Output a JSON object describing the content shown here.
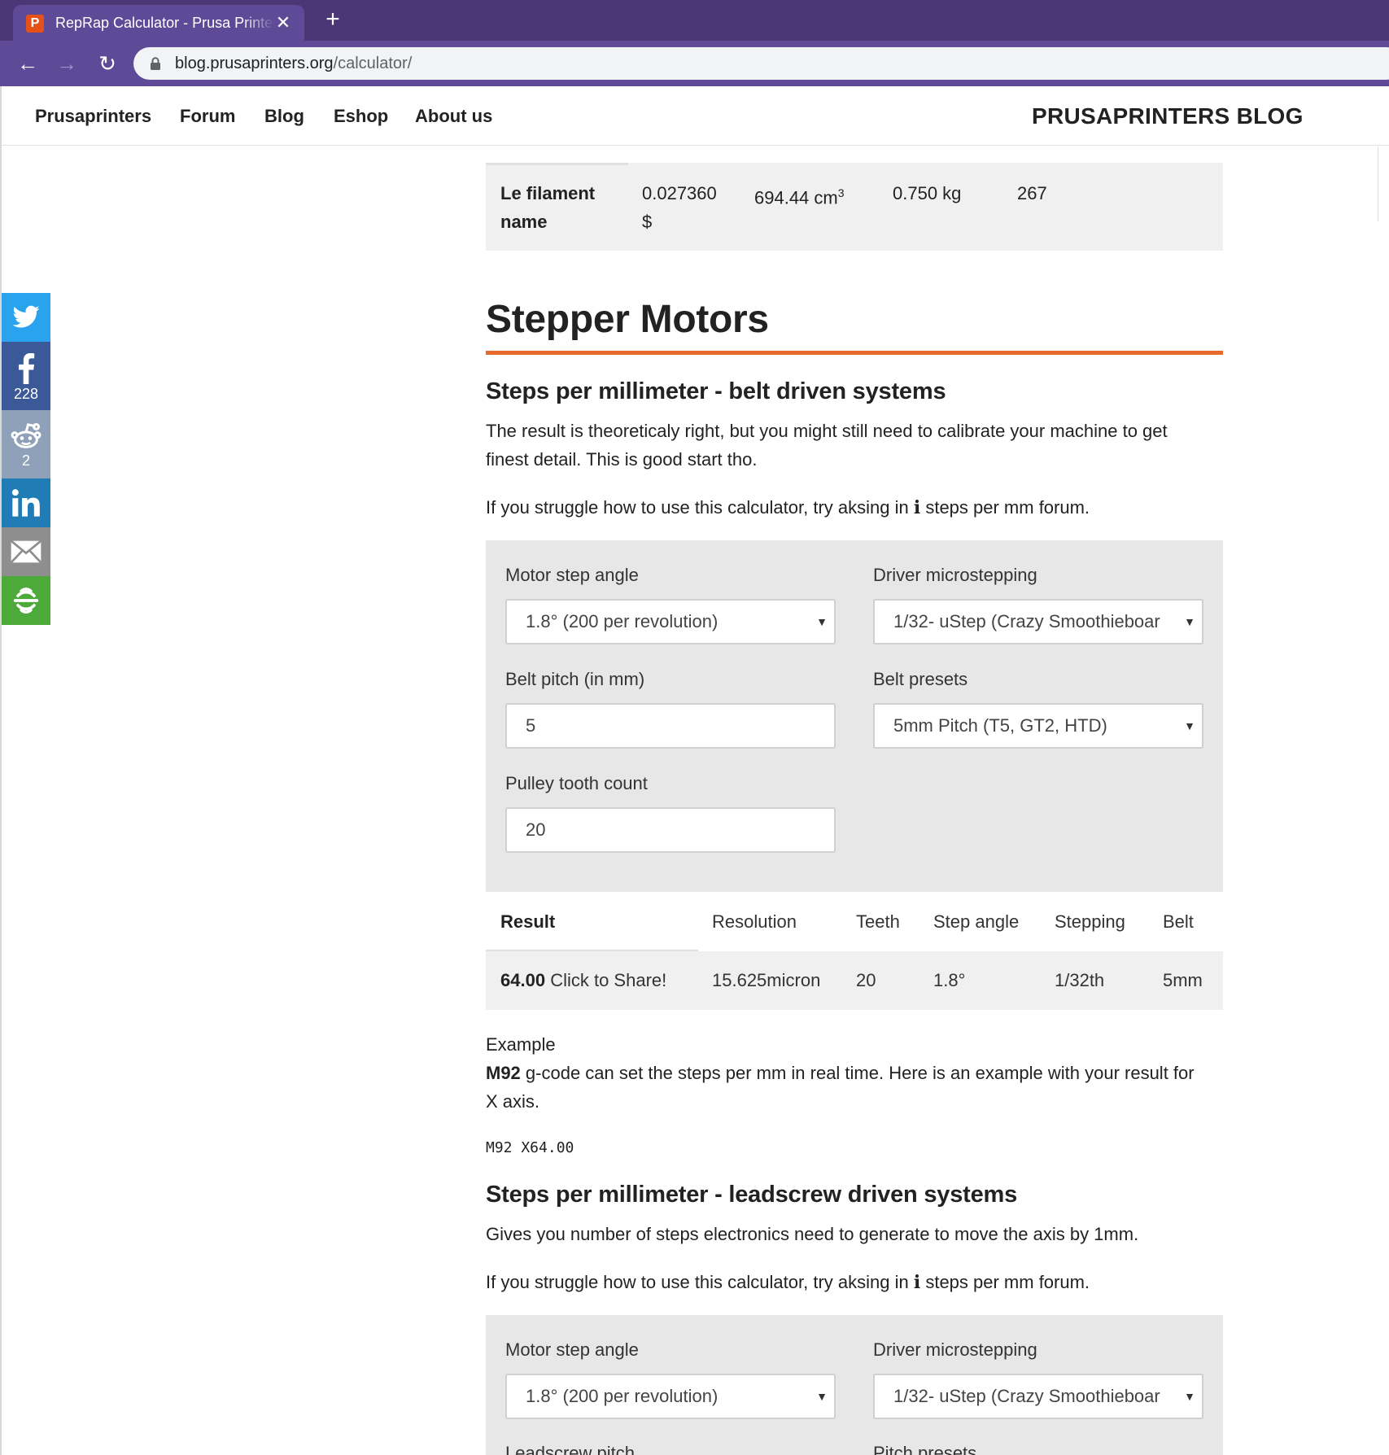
{
  "browser": {
    "tab_title": "RepRap Calculator - Prusa Printers",
    "favicon_letter": "P",
    "url_domain": "blog.prusaprinters.org",
    "url_path": "/calculator/"
  },
  "nav": {
    "links": [
      "Prusaprinters",
      "Forum",
      "Blog",
      "Eshop",
      "About us"
    ],
    "brand": "PRUSAPRINTERS BLOG"
  },
  "share": {
    "facebook_count": "228",
    "reddit_count": "2",
    "colors": {
      "twitter": "#2aa3ef",
      "facebook": "#3b5998",
      "reddit": "#8fa1b8",
      "linkedin": "#1f7cb5",
      "email": "#8e8e8e",
      "more": "#4caa3a"
    }
  },
  "filament_row": {
    "name_line1": "Le filament",
    "name_line2": "name",
    "price_line1": "0.027360",
    "price_line2": "$",
    "volume": "694.44 cm",
    "volume_sup": "3",
    "weight": "0.750 kg",
    "length": "267"
  },
  "section": {
    "title": "Stepper Motors",
    "accent": "#e86a2f"
  },
  "belt": {
    "heading": "Steps per millimeter - belt driven systems",
    "intro_line1": "The result is theoreticaly right, but you might still need to calibrate your machine to get",
    "intro_line2": "finest detail. This is good start tho.",
    "help_prefix": "If you struggle how to use this calculator, try aksing in",
    "help_icon": "i",
    "help_suffix": "steps per mm forum.",
    "fields": {
      "motor_step_angle_label": "Motor step angle",
      "motor_step_angle_value": "1.8° (200 per revolution)",
      "driver_microstepping_label": "Driver microstepping",
      "driver_microstepping_value": "1/32- uStep (Crazy Smoothieboar",
      "belt_pitch_label": "Belt pitch (in mm)",
      "belt_pitch_value": "5",
      "belt_presets_label": "Belt presets",
      "belt_presets_value": "5mm Pitch (T5, GT2, HTD)",
      "pulley_tooth_label": "Pulley tooth count",
      "pulley_tooth_value": "20"
    },
    "result": {
      "headers": [
        "Result",
        "Resolution",
        "Teeth",
        "Step angle",
        "Stepping",
        "Belt"
      ],
      "value": "64.00",
      "share_text": "Click to Share!",
      "resolution": "15.625micron",
      "teeth": "20",
      "step_angle": "1.8°",
      "stepping": "1/32th",
      "belt": "5mm"
    },
    "example_label": "Example",
    "example_code_word": "M92",
    "example_text_line1": " g-code can set the steps per mm in real time. Here is an example with your result for",
    "example_text_line2": "X axis.",
    "code": "M92 X64.00"
  },
  "leadscrew": {
    "heading": "Steps per millimeter - leadscrew driven systems",
    "intro": "Gives you number of steps electronics need to generate to move the axis by 1mm.",
    "help_prefix": "If you struggle how to use this calculator, try aksing in",
    "help_icon": "i",
    "help_suffix": "steps per mm forum.",
    "fields": {
      "motor_step_angle_label": "Motor step angle",
      "motor_step_angle_value": "1.8° (200 per revolution)",
      "driver_microstepping_label": "Driver microstepping",
      "driver_microstepping_value": "1/32- uStep (Crazy Smoothieboar",
      "leadscrew_pitch_label": "Leadscrew pitch",
      "pitch_presets_label": "Pitch presets"
    }
  }
}
